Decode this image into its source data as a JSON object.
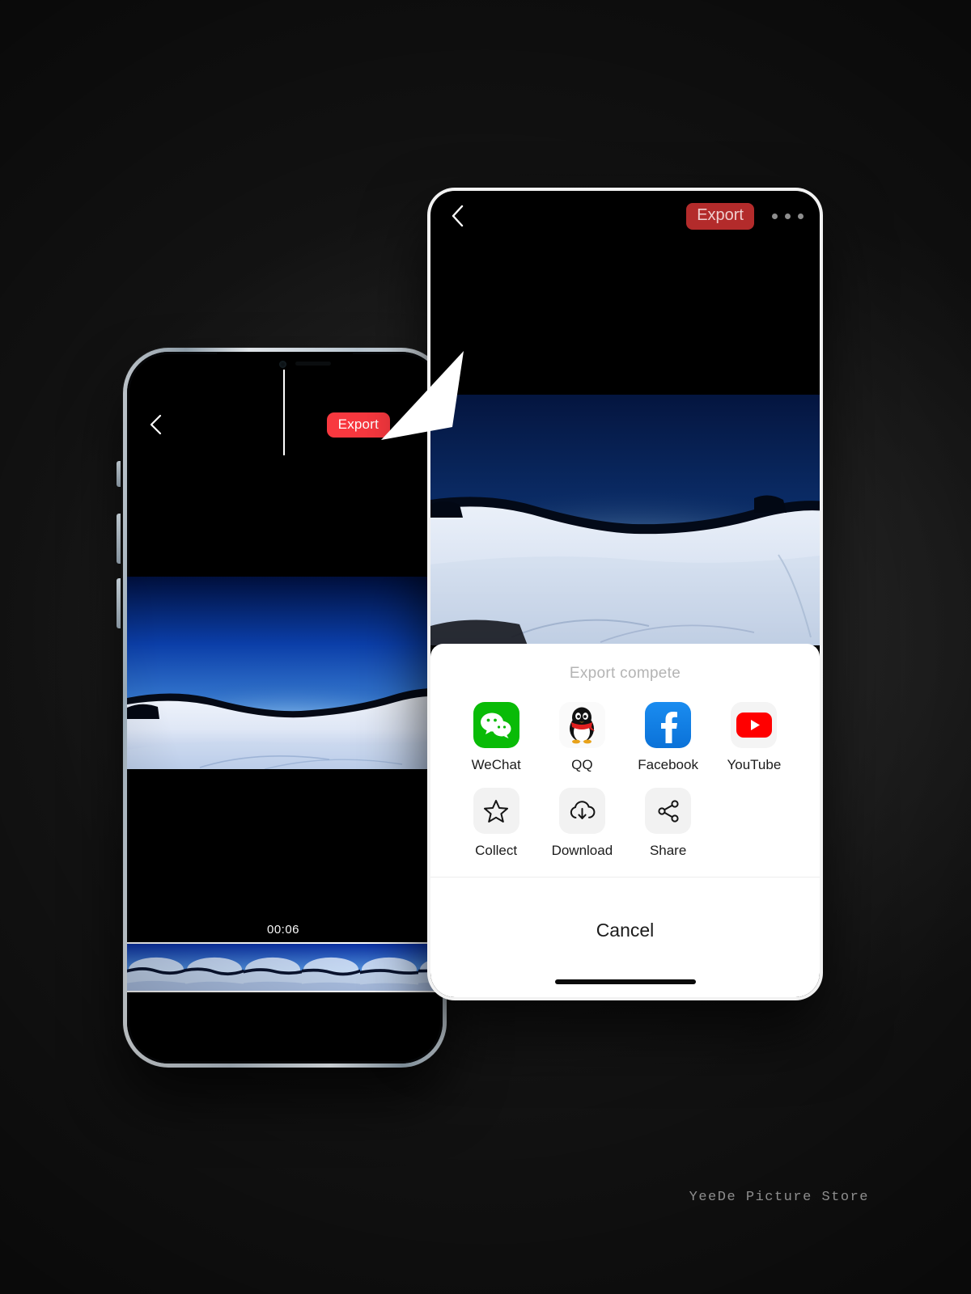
{
  "background": {
    "color": "#151515"
  },
  "watermark": {
    "text": "YeeDe Picture Store"
  },
  "left_phone": {
    "topbar": {
      "back_icon": "chevron-left-icon",
      "export_label": "Export",
      "export_color": "#f8383f",
      "more_icon": "more-dots-icon"
    },
    "timeline": {
      "current_time": "00:06",
      "playhead_visible": true,
      "frame_count": 8
    }
  },
  "right_phone": {
    "topbar": {
      "back_icon": "chevron-left-icon",
      "export_label": "Export",
      "export_color": "#b32b2b",
      "more_icon": "more-dots-icon"
    },
    "share_sheet": {
      "title": "Export compete",
      "apps_row1": [
        {
          "label": "WeChat",
          "icon": "wechat-icon",
          "color": "#09bb07"
        },
        {
          "label": "QQ",
          "icon": "qq-penguin-icon",
          "color": "#fafafa"
        },
        {
          "label": "Facebook",
          "icon": "facebook-icon",
          "color": "#1a8cf0"
        },
        {
          "label": "YouTube",
          "icon": "youtube-icon",
          "color": "#ff0000"
        }
      ],
      "apps_row2": [
        {
          "label": "Collect",
          "icon": "star-icon",
          "color": "#f2f2f2"
        },
        {
          "label": "Download",
          "icon": "cloud-download-icon",
          "color": "#f2f2f2"
        },
        {
          "label": "Share",
          "icon": "share-nodes-icon",
          "color": "#f2f2f2"
        }
      ],
      "cancel_label": "Cancel"
    }
  }
}
